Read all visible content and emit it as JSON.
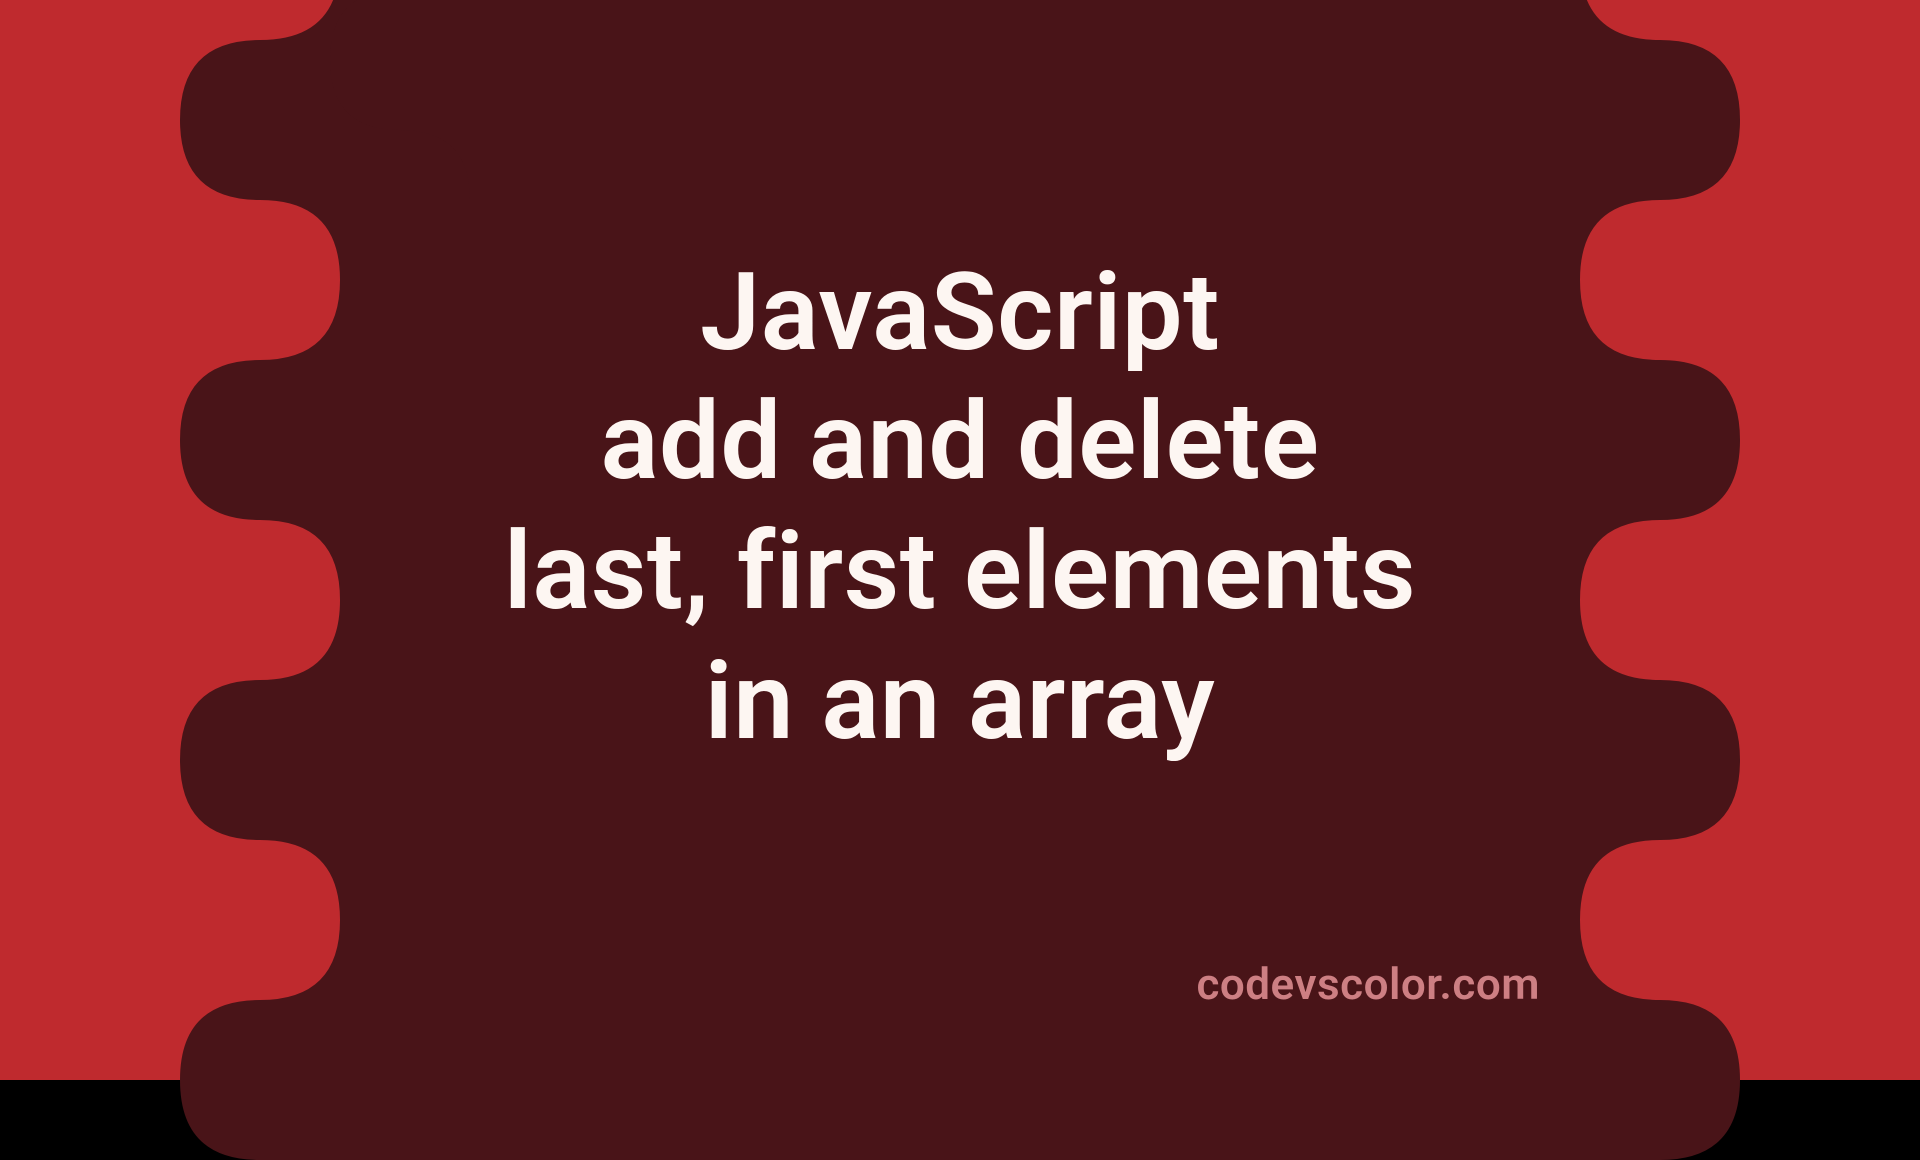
{
  "banner": {
    "title_lines": "JavaScript\nadd and delete\nlast, first elements\nin an array",
    "watermark": "codevscolor.com",
    "colors": {
      "outer_bg": "#bf2a2e",
      "blob_bg": "#491418",
      "title_text": "#fdf6f2",
      "watermark_text": "#cd7f83"
    }
  }
}
